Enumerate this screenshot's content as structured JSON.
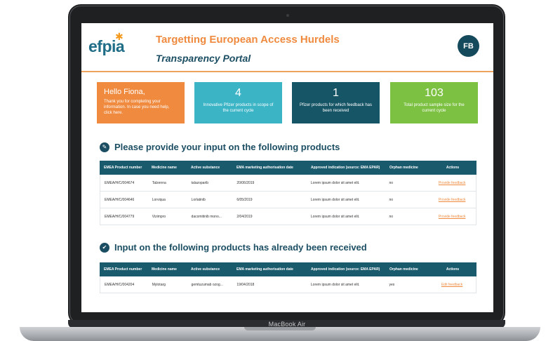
{
  "device": {
    "label": "MacBook Air"
  },
  "header": {
    "logo_text": "efpia",
    "title": "Targetting European Access Hurdels",
    "subtitle": "Transparency Portal",
    "avatar_initials": "FB"
  },
  "cards": {
    "hello": {
      "title": "Hello Fiona,",
      "text": "Thank you for completing your information. In case you need help, click here."
    },
    "innovative": {
      "value": "4",
      "text": "Innovative Pfizer products in scope of the current cycle"
    },
    "feedback": {
      "value": "1",
      "text": "Pfizer products for which feedback has been received"
    },
    "sample": {
      "value": "103",
      "text": "Total product sample size for the current cycle"
    }
  },
  "sections": {
    "pending_title": "Please provide your input on the following products",
    "received_title": "Input on the following products has already been received"
  },
  "columns": [
    "EMEA Product number",
    "Medicine name",
    "Active substance",
    "EMA marketing authorisation date",
    "Approved indication (source: EMA EPAR)",
    "Orphan medicine",
    "Actions"
  ],
  "pending_rows": [
    [
      "EMEA/H/C/004674",
      "Talzenna",
      "talazoparib",
      "20/06/2019",
      "Lorem ipsum dolor sit amet elit.",
      "no",
      "Provide feedback"
    ],
    [
      "EMEA/H/C/004646",
      "Lorviqua",
      "Lorlatinib",
      "6/05/2019",
      "Lorem ipsum dolor sit amet elit.",
      "no",
      "Provide feedback"
    ],
    [
      "EMEA/H/C/004779",
      "Vizimpro",
      "dacomitinib mono...",
      "2/04/2019",
      "Lorem ipsum dolor sit amet elit.",
      "no",
      "Provide feedback"
    ]
  ],
  "received_rows": [
    [
      "EMEA/H/C/004204",
      "Mylotarg",
      "gemtuzumab ozog...",
      "19/04/2018",
      "Lorem ipsum dolor sit amet elit.",
      "yes",
      "Edit feedback"
    ]
  ]
}
